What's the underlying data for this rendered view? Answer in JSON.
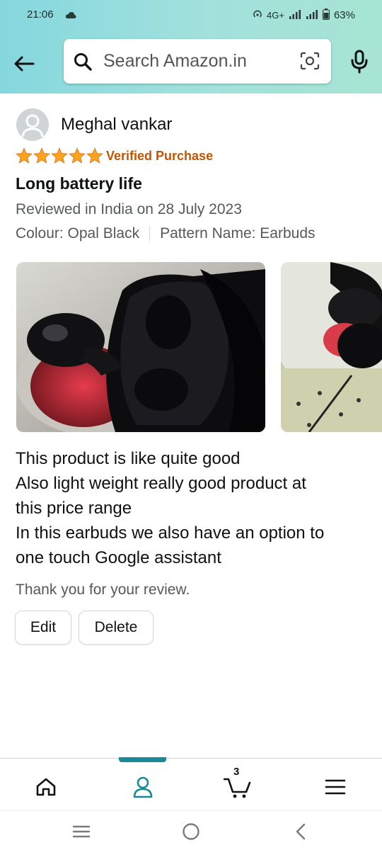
{
  "status_bar": {
    "time": "21:06",
    "network": "4G+",
    "battery": "63%"
  },
  "header": {
    "search_placeholder": "Search Amazon.in",
    "accent_color": "#85d7de"
  },
  "review": {
    "reviewer_name": "Meghal vankar",
    "rating": 5,
    "rating_max": 5,
    "verified_label": "Verified Purchase",
    "title": "Long battery life",
    "date_line": "Reviewed in India on 28 July 2023",
    "colour": "Colour: Opal Black",
    "pattern": "Pattern Name: Earbuds",
    "body_lines": [
      "This product is like quite good",
      "Also light weight really good product at",
      "this price range",
      "In this earbuds we also have an option to",
      "one touch Google assistant"
    ],
    "thanks": "Thank you for your review.",
    "edit_label": "Edit",
    "delete_label": "Delete",
    "star_color": "#ffa41c"
  },
  "bottom_nav": {
    "cart_count": "3",
    "active_tab": "account"
  }
}
